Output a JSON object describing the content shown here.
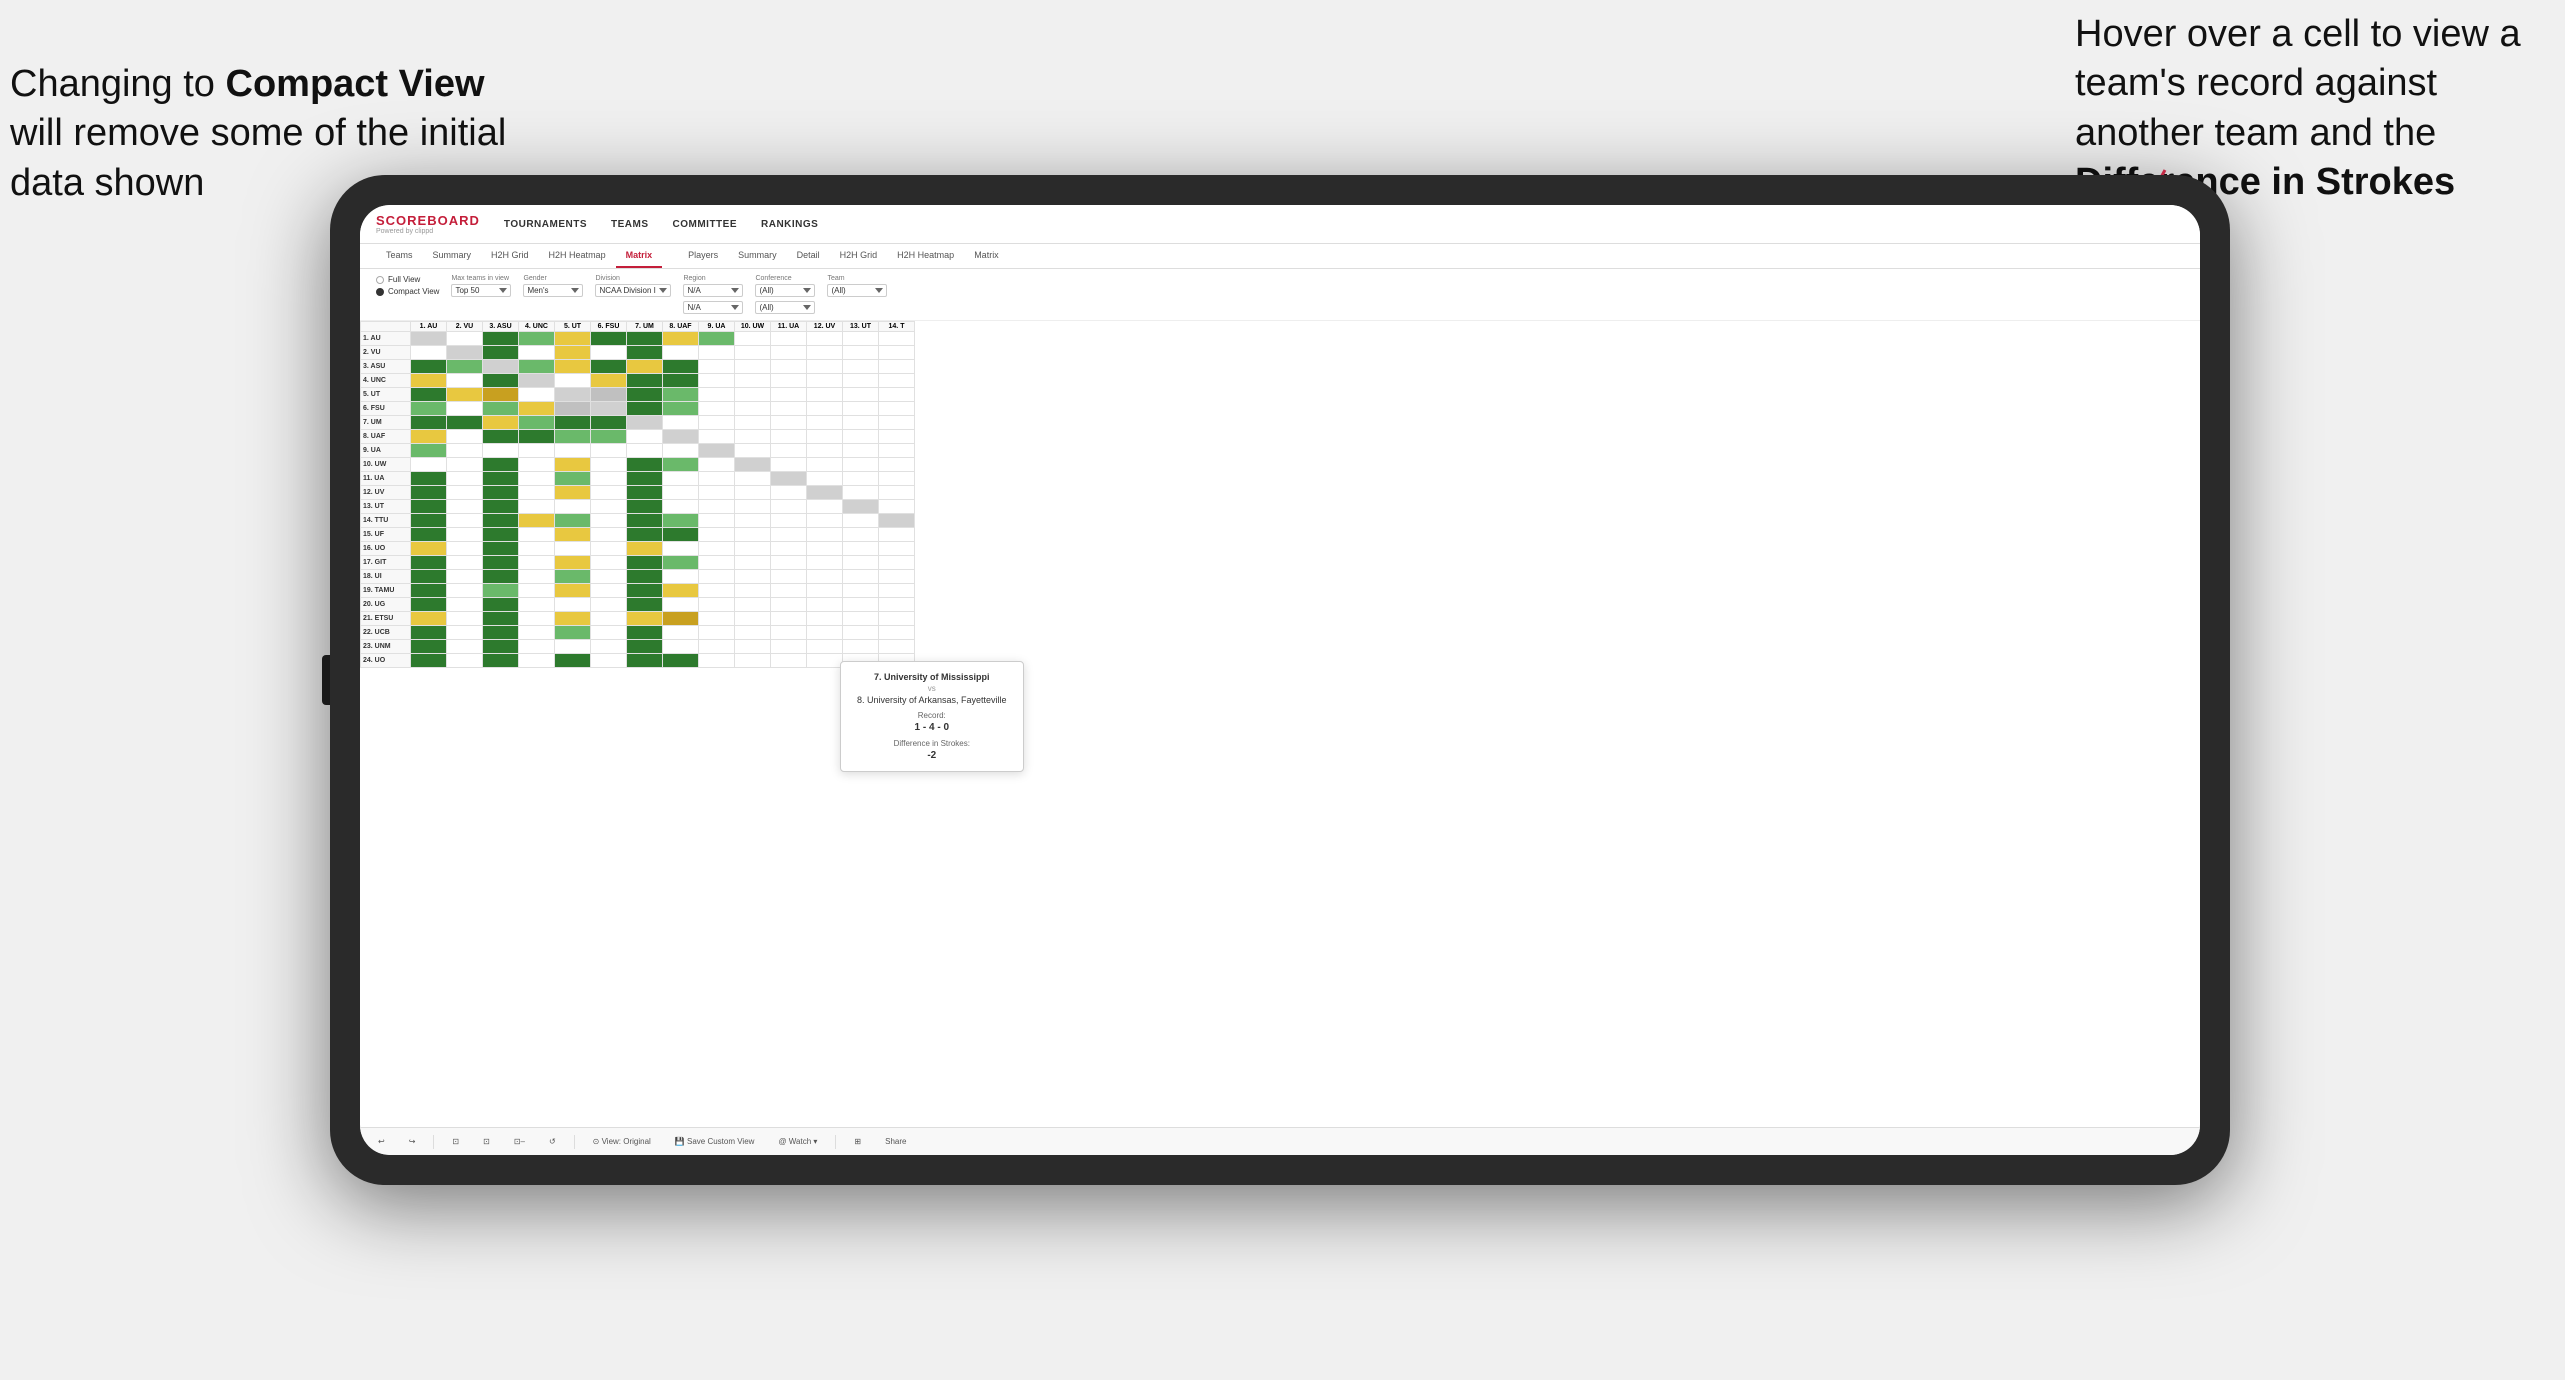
{
  "annotations": {
    "left_text": "Changing to Compact View will remove some of the initial data shown",
    "left_bold": "Compact View",
    "right_text": "Hover over a cell to view a team's record against another team and the Difference in Strokes",
    "right_bold": "Difference in Strokes"
  },
  "nav": {
    "logo_title": "SCOREBOARD",
    "logo_subtitle": "Powered by clippd",
    "items": [
      "TOURNAMENTS",
      "TEAMS",
      "COMMITTEE",
      "RANKINGS"
    ]
  },
  "sub_nav": {
    "teams_tabs": [
      "Teams",
      "Summary",
      "H2H Grid",
      "H2H Heatmap",
      "Matrix"
    ],
    "players_label": "Players",
    "players_tabs": [
      "Summary",
      "Detail",
      "H2H Grid",
      "H2H Heatmap",
      "Matrix"
    ],
    "active": "Matrix"
  },
  "controls": {
    "view_options": [
      "Full View",
      "Compact View"
    ],
    "selected_view": "Compact View",
    "filters": [
      {
        "label": "Max teams in view",
        "value": "Top 50"
      },
      {
        "label": "Gender",
        "value": "Men's"
      },
      {
        "label": "Division",
        "value": "NCAA Division I"
      },
      {
        "label": "Region",
        "value": "N/A",
        "second_value": "N/A"
      },
      {
        "label": "Conference",
        "value": "(All)",
        "second_value": "(All)"
      },
      {
        "label": "Team",
        "value": "(All)"
      }
    ]
  },
  "matrix": {
    "col_headers": [
      "1. AU",
      "2. VU",
      "3. ASU",
      "4. UNC",
      "5. UT",
      "6. FSU",
      "7. UM",
      "8. UAF",
      "9. UA",
      "10. UW",
      "11. UA",
      "12. UV",
      "13. UT",
      "14. T"
    ],
    "rows": [
      {
        "label": "1. AU",
        "cells": [
          "self",
          "",
          "green-dark",
          "green-light",
          "yellow",
          "green-dark",
          "green-dark",
          "yellow",
          "green-light",
          "",
          "",
          "",
          "",
          ""
        ]
      },
      {
        "label": "2. VU",
        "cells": [
          "",
          "self",
          "green-dark",
          "",
          "yellow",
          "",
          "green-dark",
          "",
          "",
          "",
          "",
          "",
          "",
          ""
        ]
      },
      {
        "label": "3. ASU",
        "cells": [
          "green-dark",
          "green-light",
          "self",
          "green-light",
          "yellow",
          "green-dark",
          "yellow",
          "green-dark",
          "",
          "",
          "",
          "",
          "",
          ""
        ]
      },
      {
        "label": "4. UNC",
        "cells": [
          "yellow",
          "",
          "green-dark",
          "self",
          "",
          "yellow",
          "green-dark",
          "green-dark",
          "",
          "",
          "",
          "",
          "",
          ""
        ]
      },
      {
        "label": "5. UT",
        "cells": [
          "green-dark",
          "yellow",
          "gold",
          "",
          "self",
          "gray",
          "green-dark",
          "green-light",
          "",
          "",
          "",
          "",
          "",
          ""
        ]
      },
      {
        "label": "6. FSU",
        "cells": [
          "green-light",
          "",
          "green-light",
          "yellow",
          "gray",
          "self",
          "green-dark",
          "green-light",
          "",
          "",
          "",
          "",
          "",
          ""
        ]
      },
      {
        "label": "7. UM",
        "cells": [
          "green-dark",
          "green-dark",
          "yellow",
          "green-light",
          "green-dark",
          "green-dark",
          "self",
          "white",
          "",
          "",
          "",
          "",
          "",
          ""
        ]
      },
      {
        "label": "8. UAF",
        "cells": [
          "yellow",
          "",
          "green-dark",
          "green-dark",
          "green-light",
          "green-light",
          "white",
          "self",
          "",
          "",
          "",
          "",
          "",
          ""
        ]
      },
      {
        "label": "9. UA",
        "cells": [
          "green-light",
          "",
          "",
          "",
          "",
          "",
          "",
          "",
          "self",
          "",
          "",
          "",
          "",
          ""
        ]
      },
      {
        "label": "10. UW",
        "cells": [
          "white",
          "white",
          "green-dark",
          "",
          "yellow",
          "",
          "green-dark",
          "green-light",
          "",
          "self",
          "",
          "",
          "",
          ""
        ]
      },
      {
        "label": "11. UA",
        "cells": [
          "green-dark",
          "",
          "green-dark",
          "",
          "green-light",
          "",
          "green-dark",
          "",
          "",
          "",
          "self",
          "",
          "",
          ""
        ]
      },
      {
        "label": "12. UV",
        "cells": [
          "green-dark",
          "",
          "green-dark",
          "",
          "yellow",
          "",
          "green-dark",
          "",
          "",
          "",
          "",
          "self",
          "",
          ""
        ]
      },
      {
        "label": "13. UT",
        "cells": [
          "green-dark",
          "",
          "green-dark",
          "",
          "",
          "",
          "green-dark",
          "",
          "",
          "",
          "",
          "",
          "self",
          ""
        ]
      },
      {
        "label": "14. TTU",
        "cells": [
          "green-dark",
          "",
          "green-dark",
          "yellow",
          "green-light",
          "",
          "green-dark",
          "green-light",
          "",
          "",
          "",
          "",
          "",
          "self"
        ]
      },
      {
        "label": "15. UF",
        "cells": [
          "green-dark",
          "",
          "green-dark",
          "",
          "yellow",
          "",
          "green-dark",
          "green-dark",
          "",
          "",
          "",
          "",
          "",
          ""
        ]
      },
      {
        "label": "16. UO",
        "cells": [
          "yellow",
          "",
          "green-dark",
          "",
          "",
          "",
          "yellow",
          "",
          "",
          "",
          "",
          "",
          "",
          ""
        ]
      },
      {
        "label": "17. GIT",
        "cells": [
          "green-dark",
          "",
          "green-dark",
          "",
          "yellow",
          "",
          "green-dark",
          "green-light",
          "",
          "",
          "",
          "",
          "",
          ""
        ]
      },
      {
        "label": "18. UI",
        "cells": [
          "green-dark",
          "",
          "green-dark",
          "",
          "green-light",
          "",
          "green-dark",
          "",
          "",
          "",
          "",
          "",
          "",
          ""
        ]
      },
      {
        "label": "19. TAMU",
        "cells": [
          "green-dark",
          "",
          "green-light",
          "",
          "yellow",
          "",
          "green-dark",
          "yellow",
          "",
          "",
          "",
          "",
          "",
          ""
        ]
      },
      {
        "label": "20. UG",
        "cells": [
          "green-dark",
          "",
          "green-dark",
          "",
          "",
          "",
          "green-dark",
          "",
          "",
          "",
          "",
          "",
          "",
          ""
        ]
      },
      {
        "label": "21. ETSU",
        "cells": [
          "yellow",
          "",
          "green-dark",
          "",
          "yellow",
          "",
          "yellow",
          "gold",
          "",
          "",
          "",
          "",
          "",
          ""
        ]
      },
      {
        "label": "22. UCB",
        "cells": [
          "green-dark",
          "",
          "green-dark",
          "",
          "green-light",
          "",
          "green-dark",
          "",
          "",
          "",
          "",
          "",
          "",
          ""
        ]
      },
      {
        "label": "23. UNM",
        "cells": [
          "green-dark",
          "",
          "green-dark",
          "",
          "",
          "",
          "green-dark",
          "",
          "",
          "",
          "",
          "",
          "",
          ""
        ]
      },
      {
        "label": "24. UO",
        "cells": [
          "green-dark",
          "",
          "green-dark",
          "",
          "green-dark",
          "",
          "green-dark",
          "green-dark",
          "",
          "",
          "",
          "",
          "",
          ""
        ]
      }
    ]
  },
  "tooltip": {
    "team1": "7. University of Mississippi",
    "vs": "vs",
    "team2": "8. University of Arkansas, Fayetteville",
    "record_label": "Record:",
    "record": "1 - 4 - 0",
    "diff_label": "Difference in Strokes:",
    "diff": "-2"
  },
  "toolbar": {
    "undo": "↩",
    "redo": "↪",
    "tools": [
      "⊡",
      "⊡",
      "⊡",
      "↺"
    ],
    "view_original": "⊙ View: Original",
    "save_custom": "💾 Save Custom View",
    "watch": "@ Watch ▾",
    "share_icon": "⊞",
    "share": "Share"
  },
  "colors": {
    "green_dark": "#2d7a2d",
    "green_light": "#6ab96a",
    "yellow": "#e8c840",
    "gold": "#c8a020",
    "gray": "#c0c0c0",
    "accent_red": "#c41e3a"
  }
}
